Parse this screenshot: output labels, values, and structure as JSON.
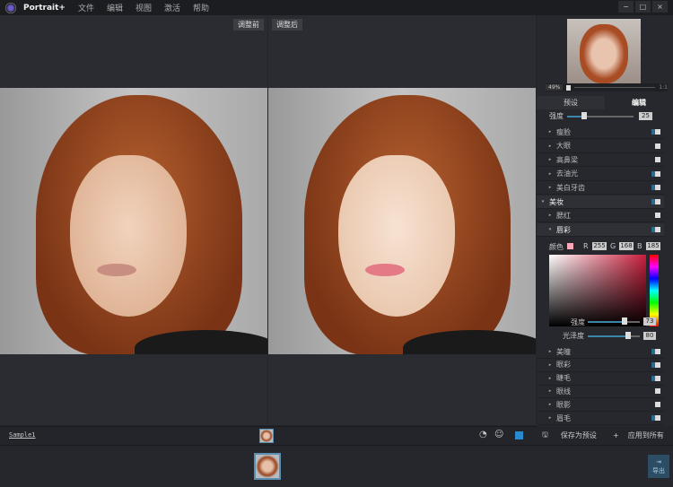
{
  "app": {
    "title": "Portrait+",
    "menu": [
      "文件",
      "编辑",
      "视图",
      "激活",
      "帮助"
    ],
    "window_buttons": [
      "−",
      "□",
      "×"
    ]
  },
  "viewer": {
    "before_label": "调整前",
    "after_label": "调整后"
  },
  "navigator": {
    "zoom": "49%",
    "fit": "1:1"
  },
  "tabs": {
    "preset": "预设",
    "edit": "编辑"
  },
  "strength": {
    "label": "强度",
    "value": "25",
    "fraction": 0.25
  },
  "features": [
    {
      "label": "瘦脸",
      "on": true
    },
    {
      "label": "大眼",
      "on": false
    },
    {
      "label": "高鼻梁",
      "on": false
    },
    {
      "label": "去油光",
      "on": true
    },
    {
      "label": "美白牙齿",
      "on": true
    }
  ],
  "makeup": {
    "label": "美妆",
    "items": [
      {
        "label": "腮红",
        "on": false
      },
      {
        "label": "唇彩",
        "on": true
      }
    ]
  },
  "lip_color": {
    "label": "颜色",
    "r_label": "R",
    "g_label": "G",
    "b_label": "B",
    "r": "255",
    "g": "168",
    "b": "185",
    "swatch": "#ffa8b9"
  },
  "lip_strength": {
    "label": "强度",
    "value": "73",
    "fraction": 0.73
  },
  "lip_gloss": {
    "label": "光泽度",
    "value": "80",
    "fraction": 0.8
  },
  "makeup_more": [
    {
      "label": "美瞳",
      "on": true
    },
    {
      "label": "眼彩",
      "on": true
    },
    {
      "label": "睫毛",
      "on": true
    },
    {
      "label": "眼线",
      "on": false
    },
    {
      "label": "眼影",
      "on": false
    },
    {
      "label": "眉毛",
      "on": true
    }
  ],
  "actions": {
    "save_preset": "保存为预设",
    "apply_all": "应用到所有",
    "export": "导出"
  },
  "bottom": {
    "filename": "Sample1"
  }
}
